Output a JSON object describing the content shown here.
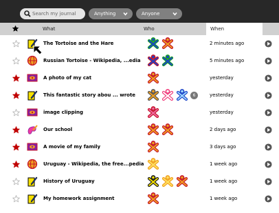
{
  "toolbar": {
    "search_placeholder": "Search my journal",
    "filter_what": "Anything",
    "filter_who": "Anyone"
  },
  "header": {
    "what": "What",
    "who": "Who",
    "when": "When",
    "star_icon": "star-icon"
  },
  "colors": {
    "toolbar": "#282828",
    "header": "#d0d0d0",
    "star_on": "#c00000"
  },
  "rows": [
    {
      "title": "The Tortoise and the Hare",
      "starred": false,
      "icon": "write-activity-icon",
      "when": "2 minutes ago",
      "buddies": [
        {
          "stroke": "#1a9d2b",
          "fill": "#1b44c8"
        },
        {
          "stroke": "#c4142a",
          "fill": "#f0a020"
        }
      ]
    },
    {
      "title": "Russian Tortoise - Wikipedia, ...edia",
      "starred": false,
      "icon": "browse-activity-icon",
      "when": "5 minutes ago",
      "buddies": [
        {
          "stroke": "#c4142a",
          "fill": "#1b44c8"
        },
        {
          "stroke": "#1a9d2b",
          "fill": "#1b44c8"
        }
      ]
    },
    {
      "title": "A photo of my cat",
      "starred": true,
      "icon": "image-icon",
      "when": "yesterday",
      "buddies": [
        {
          "stroke": "#c4142a",
          "fill": "#f0a020"
        }
      ]
    },
    {
      "title": "This fantastic story abou ... wrote",
      "starred": true,
      "icon": "write-activity-icon",
      "when": "yesterday",
      "buddies": [
        {
          "stroke": "#555555",
          "fill": "#f0a020"
        },
        {
          "stroke": "#f03a7a",
          "fill": "#ffffff"
        },
        {
          "stroke": "#1b44c8",
          "fill": "#9fd8ff"
        }
      ],
      "more": "6"
    },
    {
      "title": "image clipping",
      "starred": false,
      "icon": "image-icon",
      "when": "yesterday",
      "buddies": [
        {
          "stroke": "#c4142a",
          "fill": "#f06aa0"
        }
      ]
    },
    {
      "title": "Our school",
      "starred": true,
      "icon": "paint-activity-icon",
      "when": "2 days ago",
      "buddies": [
        {
          "stroke": "#c4142a",
          "fill": "#f0a020"
        },
        {
          "stroke": "#c4142a",
          "fill": "#f0a020"
        }
      ]
    },
    {
      "title": "A movie of my family",
      "starred": true,
      "icon": "video-icon",
      "when": "3 days ago",
      "buddies": [
        {
          "stroke": "#c4142a",
          "fill": "#f0a020"
        }
      ]
    },
    {
      "title": "Uruguay - Wikipedia, the free...pedia",
      "starred": true,
      "icon": "browse-activity-icon",
      "when": "1 week ago",
      "buddies": [
        {
          "stroke": "#f0a020",
          "fill": "#ffe060"
        }
      ]
    },
    {
      "title": "History of Uruguay",
      "starred": false,
      "icon": "write-activity-icon",
      "when": "1 week ago",
      "buddies": [
        {
          "stroke": "#1a1a1a",
          "fill": "#f5e000"
        },
        {
          "stroke": "#f0a020",
          "fill": "#ffe060"
        },
        {
          "stroke": "#c4142a",
          "fill": "#f0a020"
        }
      ]
    },
    {
      "title": "My homework assignment",
      "starred": false,
      "icon": "write-activity-icon",
      "when": "1 week ago",
      "buddies": [
        {
          "stroke": "#c4142a",
          "fill": "#f0a020"
        }
      ]
    }
  ]
}
